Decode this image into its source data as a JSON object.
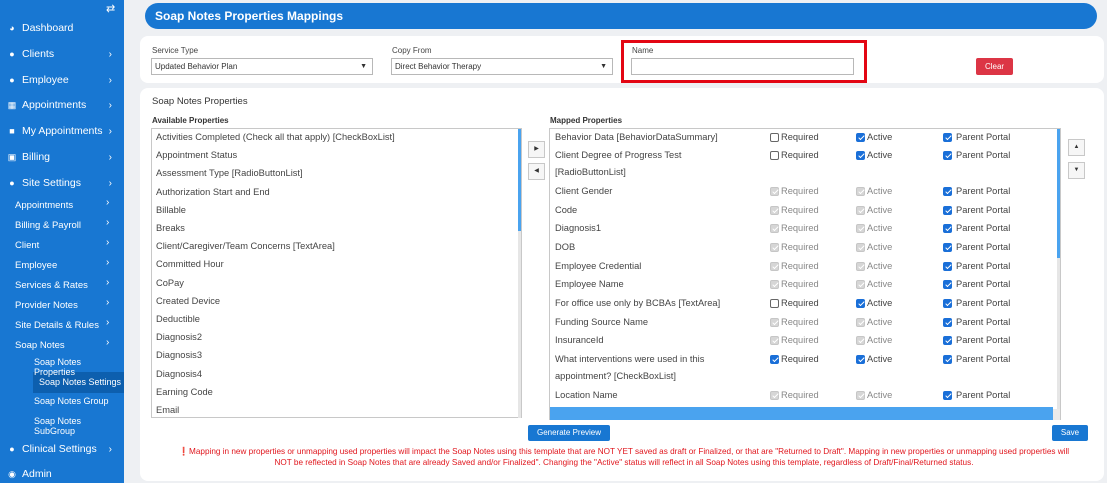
{
  "sidebar": {
    "toggle_icon": "⇄",
    "items": [
      {
        "label": "Dashboard",
        "icon": "dashboard-icon",
        "glyph": "◕"
      },
      {
        "label": "Clients",
        "icon": "user-icon",
        "glyph": "●"
      },
      {
        "label": "Employee",
        "icon": "users-icon",
        "glyph": "●"
      },
      {
        "label": "Appointments",
        "icon": "calendar-icon",
        "glyph": "▦"
      },
      {
        "label": "My Appointments",
        "icon": "book-icon",
        "glyph": "■"
      },
      {
        "label": "Billing",
        "icon": "money-icon",
        "glyph": "▣"
      },
      {
        "label": "Site Settings",
        "icon": "user-settings-icon",
        "glyph": "●"
      }
    ],
    "site_settings_children": [
      "Appointments",
      "Billing & Payroll",
      "Client",
      "Employee",
      "Services & Rates",
      "Provider Notes",
      "Site Details & Rules",
      "Soap Notes"
    ],
    "soap_notes_children": [
      "Soap Notes Properties",
      "Soap Notes Settings",
      "Soap Notes Group",
      "Soap Notes SubGroup"
    ],
    "bottom_items": [
      {
        "label": "Clinical Settings",
        "icon": "user-icon",
        "glyph": "●"
      },
      {
        "label": "Admin",
        "icon": "user-circle-icon",
        "glyph": "◉"
      }
    ]
  },
  "header": {
    "title": "Soap Notes Properties Mappings"
  },
  "filters": {
    "service_type_label": "Service Type",
    "service_type_value": "Updated Behavior Plan",
    "copy_from_label": "Copy From",
    "copy_from_value": "Direct Behavior Therapy",
    "name_label": "Name",
    "name_value": "",
    "clear_label": "Clear"
  },
  "properties": {
    "section_title": "Soap Notes Properties",
    "available_title": "Available Properties",
    "mapped_title": "Mapped Properties",
    "available": [
      "Activities Completed (Check all that apply) [CheckBoxList]",
      "Appointment Status",
      "Assessment Type [RadioButtonList]",
      "Authorization Start and End",
      "Billable",
      "Breaks",
      "Client/Caregiver/Team Concerns [TextArea]",
      "Committed Hour",
      "CoPay",
      "Created Device",
      "Deductible",
      "Diagnosis2",
      "Diagnosis3",
      "Diagnosis4",
      "Earning Code",
      "Email"
    ],
    "required_label": "Required",
    "active_label": "Active",
    "parent_portal_label": "Parent Portal",
    "mapped": [
      {
        "lines": [
          "Behavior Data [BehaviorDataSummary]"
        ],
        "required": "off",
        "active": "on",
        "portal": "on"
      },
      {
        "lines": [
          "Client Degree of Progress Test",
          "[RadioButtonList]"
        ],
        "required": "off",
        "active": "on",
        "portal": "on"
      },
      {
        "lines": [
          "Client Gender"
        ],
        "required": "dis",
        "active": "dis",
        "portal": "on"
      },
      {
        "lines": [
          "Code"
        ],
        "required": "dis",
        "active": "dis",
        "portal": "on"
      },
      {
        "lines": [
          "Diagnosis1"
        ],
        "required": "dis",
        "active": "dis",
        "portal": "on"
      },
      {
        "lines": [
          "DOB"
        ],
        "required": "dis",
        "active": "dis",
        "portal": "on"
      },
      {
        "lines": [
          "Employee Credential"
        ],
        "required": "dis",
        "active": "dis",
        "portal": "on"
      },
      {
        "lines": [
          "Employee Name"
        ],
        "required": "dis",
        "active": "dis",
        "portal": "on"
      },
      {
        "lines": [
          "For office use only by BCBAs [TextArea]"
        ],
        "required": "off",
        "active": "on",
        "portal": "on"
      },
      {
        "lines": [
          "Funding Source Name"
        ],
        "required": "dis",
        "active": "dis",
        "portal": "on"
      },
      {
        "lines": [
          "InsuranceId"
        ],
        "required": "dis",
        "active": "dis",
        "portal": "on"
      },
      {
        "lines": [
          "What interventions were used in this",
          "appointment? [CheckBoxList]"
        ],
        "required": "on",
        "active": "on",
        "portal": "on"
      },
      {
        "lines": [
          "Location Name"
        ],
        "required": "dis",
        "active": "dis",
        "portal": "on"
      }
    ]
  },
  "buttons": {
    "generate_preview": "Generate Preview",
    "save": "Save"
  },
  "warning": {
    "line1": "❗Mapping in new properties or unmapping used properties will impact the Soap Notes using this template that are NOT YET saved as draft or Finalized, or that are \"Returned to Draft\". Mapping in new properties or unmapping used properties will",
    "line2": "NOT be reflected in Soap Notes that are already Saved and/or Finalized\". Changing the \"Active\" status will reflect in all Soap Notes using this template, regardless of Draft/Final/Returned status."
  },
  "colors": {
    "brand": "#1877d2",
    "danger": "#dc3545",
    "highlight": "#e30613"
  }
}
